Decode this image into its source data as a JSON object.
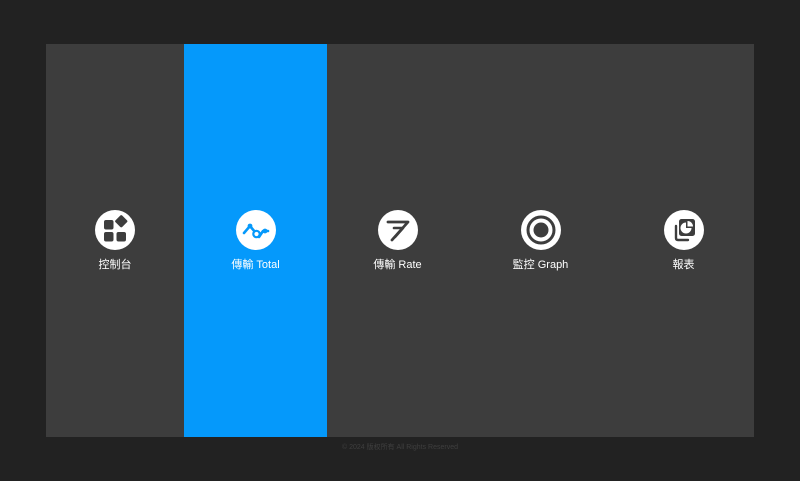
{
  "colors": {
    "page_background": "#222222",
    "panel_background": "#3d3d3d",
    "active_tile": "#0599fb",
    "icon_circle": "#ffffff",
    "text": "#ffffff",
    "footer_text": "#3f3f3f"
  },
  "tiles": [
    {
      "label": "控制台",
      "icon": "dashboard-icon",
      "active": false
    },
    {
      "label": "傳輸 Total",
      "icon": "trend-line-icon",
      "active": true
    },
    {
      "label": "傳輸 Rate",
      "icon": "send-arrow-icon",
      "active": false
    },
    {
      "label": "監控 Graph",
      "icon": "target-ring-icon",
      "active": false
    },
    {
      "label": "報表",
      "icon": "pie-report-icon",
      "active": false
    }
  ],
  "footer": {
    "text": "© 2024 版权所有 All Rights Reserved"
  }
}
